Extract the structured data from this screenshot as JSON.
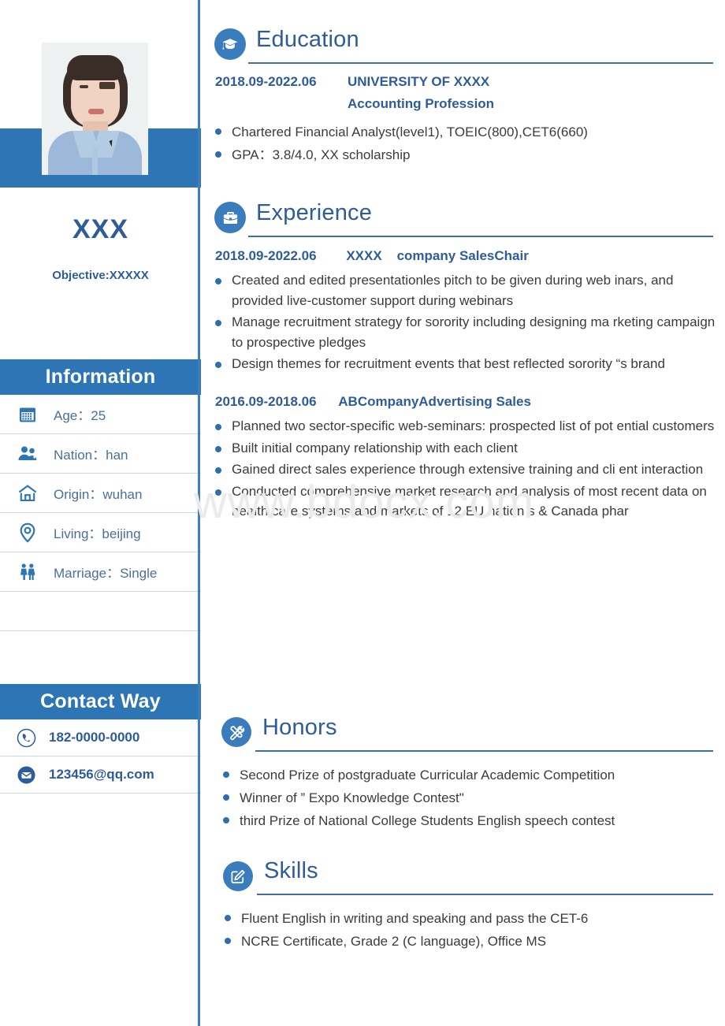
{
  "theme": {
    "accent_blue": "#2E75B5",
    "deep_blue": "#2E5C9A",
    "bullet_blue": "#2E6EAF",
    "rule_blue": "#3C6FA8",
    "body_text": "#3b3b3b"
  },
  "watermark": {
    "text": "www.bdocx.com"
  },
  "sidebar": {
    "name": "XXX",
    "objective": "Objective:XXXXX",
    "photo_alt": "profile-photo",
    "information": {
      "heading": "Information",
      "rows": [
        {
          "icon": "calendar-icon",
          "text": "Age：25"
        },
        {
          "icon": "people-icon",
          "text": "Nation：han"
        },
        {
          "icon": "home-icon",
          "text": "Origin：wuhan"
        },
        {
          "icon": "location-icon",
          "text": "Living：beijing"
        },
        {
          "icon": "couple-icon",
          "text": "Marriage：Single"
        }
      ]
    },
    "contact": {
      "heading": "Contact Way",
      "rows": [
        {
          "icon": "phone-icon",
          "text": "182-0000-0000"
        },
        {
          "icon": "mail-icon",
          "text": "123456@qq.com"
        }
      ]
    }
  },
  "main": {
    "education": {
      "title": "Education",
      "icon": "graduation-cap-icon",
      "dates": "2018.09-2022.06",
      "school": "UNIVERSITY OF XXXX",
      "major": "Accounting Profession",
      "bullets": [
        "Chartered Financial Analyst(level1), TOEIC(800),CET6(660)",
        "GPA：3.8/4.0, XX scholarship"
      ]
    },
    "experience": {
      "title": "Experience",
      "icon": "briefcase-icon",
      "entries": [
        {
          "header": "2018.09-2022.06        XXXX    company SalesChair",
          "bullets": [
            "Created and edited presentationles pitch to be given during web inars, and provided live-customer support during webinars",
            "Manage recruitment strategy for sorority including designing ma rketing campaign to prospective pledges",
            "Design themes for recruitment events that best reflected sorority “s brand"
          ]
        },
        {
          "header": "2016.09-2018.06      ABCompanyAdvertising Sales",
          "bullets": [
            "Planned two sector-specific web-seminars: prospected list of pot ential customers",
            "Built initial company relationship with each client",
            "Gained direct sales experience through extensive training and cli ent interaction",
            "Conducted comprehensive market research and analysis of most recent data on health care systems and markets of 12 EU nation s & Canada phar"
          ]
        }
      ]
    },
    "honors": {
      "title": "Honors",
      "icon": "tools-icon",
      "bullets": [
        "Second Prize of postgraduate Curricular Academic Competition",
        "Winner of ”  Expo Knowledge Contest\"",
        "third Prize of National College Students English speech contest"
      ]
    },
    "skills": {
      "title": "Skills",
      "icon": "pencil-edit-icon",
      "bullets": [
        "Fluent English in writing and speaking and pass the CET-6",
        "NCRE Certificate, Grade 2 (C language), Office MS"
      ]
    }
  }
}
